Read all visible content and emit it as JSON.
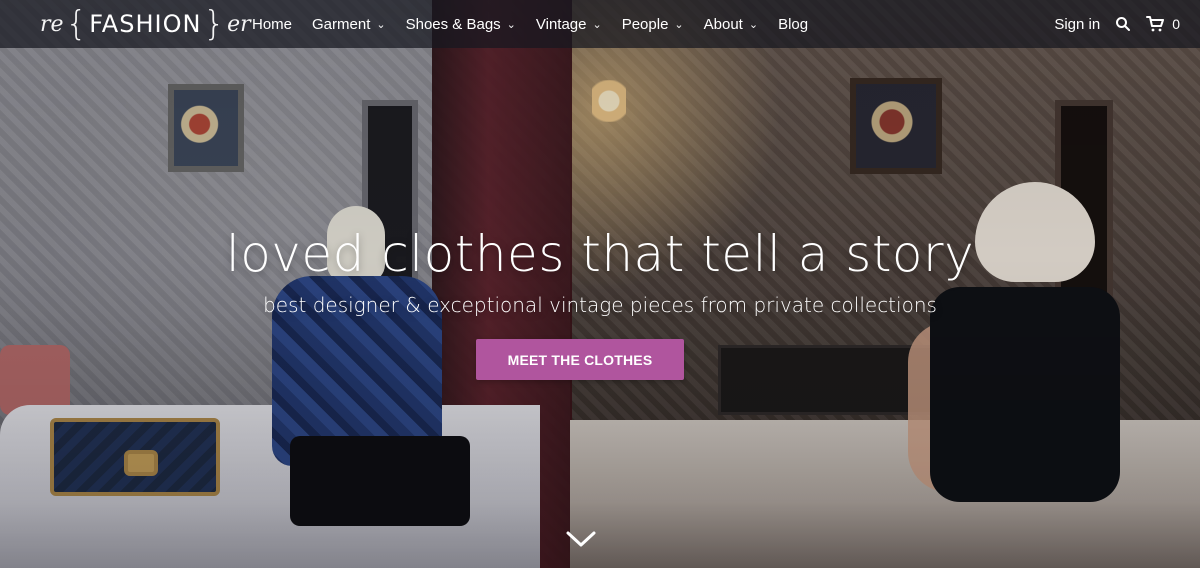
{
  "brand": {
    "prefix": "re",
    "core": "FASHION",
    "suffix": "er"
  },
  "nav": {
    "items": [
      {
        "label": "Home",
        "has_dropdown": false
      },
      {
        "label": "Garment",
        "has_dropdown": true
      },
      {
        "label": "Shoes & Bags",
        "has_dropdown": true
      },
      {
        "label": "Vintage",
        "has_dropdown": true
      },
      {
        "label": "People",
        "has_dropdown": true
      },
      {
        "label": "About",
        "has_dropdown": true
      },
      {
        "label": "Blog",
        "has_dropdown": false
      }
    ]
  },
  "actions": {
    "signin_label": "Sign in",
    "search_icon": "search-icon",
    "cart_icon": "cart-icon",
    "cart_count": "0"
  },
  "hero": {
    "headline": "loved clothes that tell a story",
    "subline": "best designer & exceptional vintage pieces from private collections",
    "cta_label": "MEET THE CLOTHES",
    "scroll_icon": "chevron-down-icon"
  },
  "colors": {
    "cta_bg": "#b0559e",
    "topbar_bg": "rgba(22, 24, 32, 0.72)",
    "text": "#ffffff"
  }
}
